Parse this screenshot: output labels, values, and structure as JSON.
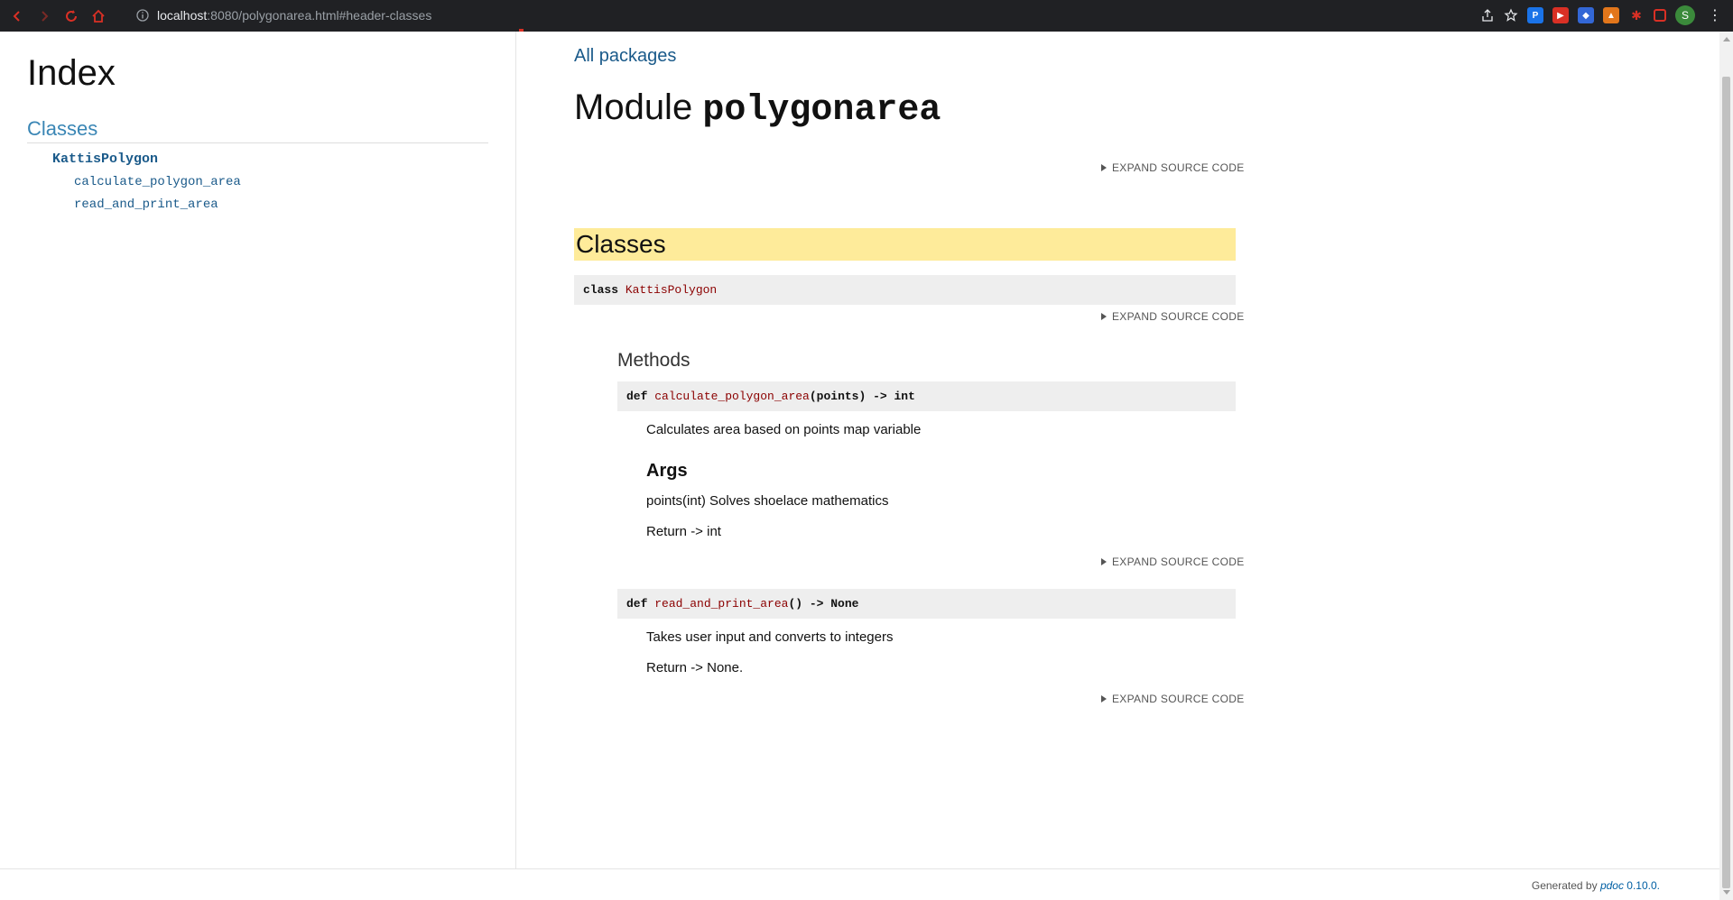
{
  "browser": {
    "url_host": "localhost",
    "url_rest": ":8080/polygonarea.html#header-classes",
    "avatar_letter": "S"
  },
  "sidebar": {
    "index_title": "Index",
    "section_title": "Classes",
    "class_name": "KattisPolygon",
    "methods": [
      "calculate_polygon_area",
      "read_and_print_area"
    ]
  },
  "main": {
    "all_packages": "All packages",
    "module_prefix": "Module ",
    "module_name": "polygonarea",
    "expand_label": "EXPAND SOURCE CODE",
    "classes_header": "Classes",
    "class_sig": {
      "keyword": "class ",
      "name": "KattisPolygon"
    },
    "methods_title": "Methods",
    "method1": {
      "keyword": "def ",
      "name": "calculate_polygon_area",
      "rest": "(points) -> int",
      "doc": "Calculates area based on points map variable",
      "args_title": "Args",
      "arg": "points(int) Solves shoelace mathematics",
      "returns": "Return -> int"
    },
    "method2": {
      "keyword": "def ",
      "name": "read_and_print_area",
      "rest": "() -> None",
      "doc": "Takes user input and converts to integers",
      "returns": "Return -> None."
    }
  },
  "footer": {
    "generated_by": "Generated by ",
    "pdoc": "pdoc",
    "version": " 0.10.0."
  },
  "colors": {
    "link": "#1a5a8a",
    "highlight": "#feeb9a",
    "function_name": "#8b0000"
  }
}
